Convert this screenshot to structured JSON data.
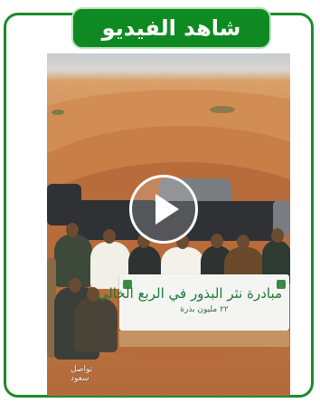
{
  "header": {
    "title": "شاهد الفيديو"
  },
  "video": {
    "banner_title": "مبادرة نثر البذور في الربع الخالي",
    "banner_subtitle": "٢٢ مليون بذرة",
    "watermark": "تواصل\nسعود"
  },
  "colors": {
    "accent": "#0f8a22",
    "border": "#1e8a2e"
  },
  "icons": {
    "play": "play-icon",
    "logo": "ministry-logo"
  }
}
